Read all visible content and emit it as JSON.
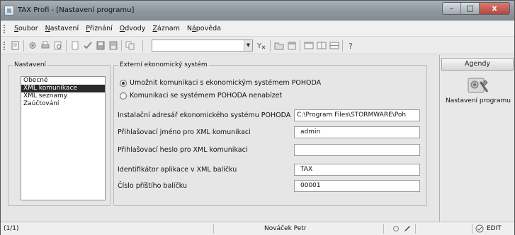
{
  "window": {
    "title": "TAX Profi - [Nastavení programu]",
    "controls": {
      "minimize": "–",
      "maximize": "□",
      "close": "x"
    }
  },
  "menu": [
    {
      "prefix": "",
      "accel": "S",
      "rest": "oubor"
    },
    {
      "prefix": "",
      "accel": "N",
      "rest": "astavení"
    },
    {
      "prefix": "",
      "accel": "P",
      "rest": "řiznání"
    },
    {
      "prefix": "",
      "accel": "O",
      "rest": "dvody"
    },
    {
      "prefix": "",
      "accel": "Z",
      "rest": "áznam"
    },
    {
      "prefix": "N",
      "accel": "á",
      "rest": "pověda"
    }
  ],
  "toolbar": {
    "combo_value": "",
    "icons": [
      "new-record-icon",
      "settings-icon",
      "print-icon",
      "print-preview-icon",
      "page-icon",
      "check-icon",
      "save-icon",
      "save-as-icon",
      "copy-icon",
      "filter-icon",
      "folder-icon",
      "calendar-icon",
      "window-icon",
      "window-cascade-icon",
      "window-tile-icon",
      "help-icon"
    ]
  },
  "nastaveni": {
    "title": "Nastavení",
    "items": [
      "Obecné",
      "XML komunikace",
      "XML seznamy",
      "Zaúčtování"
    ],
    "selected_index": 1
  },
  "externi": {
    "title": "Externí ekonomický systém",
    "radio_enable": "Umožnit komunikaci s ekonomickým systémem POHODA",
    "radio_disable": "Komunikaci se systémem POHODA nenabízet",
    "enabled": true,
    "fields": {
      "install_dir": {
        "label": "Instalační adresář ekonomického systému POHODA",
        "value": "C:\\Program Files\\STORMWARE\\Poh"
      },
      "login": {
        "label": "Přihlašovací jméno pro XML komunikaci",
        "value": "admin"
      },
      "password": {
        "label": "Přihlašovací heslo pro XML komunikaci",
        "value": ""
      },
      "app_id": {
        "label": "Identifikátor aplikace v XML balíčku",
        "value": "TAX"
      },
      "next_package": {
        "label": "Číslo příštího balíčku",
        "value": "00001"
      }
    },
    "browse_label": "..."
  },
  "agendy": {
    "title": "Agendy",
    "items": [
      {
        "label": "Nastavení programu",
        "icon": "settings-tools-icon"
      }
    ]
  },
  "status": {
    "record": "(1/1)",
    "user": "Nováček Petr",
    "mode": "EDIT"
  },
  "colors": {
    "titlebar": "#8e969e",
    "close_button": "#b8473e",
    "selection": "#2a2a2a"
  }
}
